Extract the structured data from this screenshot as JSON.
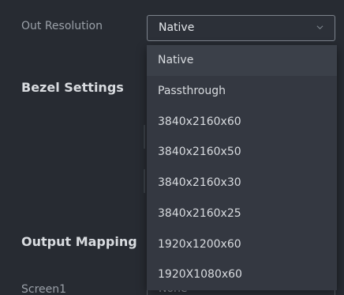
{
  "out_resolution": {
    "label": "Out Resolution",
    "value": "Native"
  },
  "sections": {
    "bezel_title": "Bezel Settings",
    "mapping_title": "Output Mapping"
  },
  "screen1": {
    "label": "Screen1",
    "value": "None"
  },
  "dropdown": {
    "options": [
      "Native",
      "Passthrough",
      "3840x2160x60",
      "3840x2160x50",
      "3840x2160x30",
      "3840x2160x25",
      "1920x1200x60",
      "1920X1080x60"
    ]
  },
  "icons": {
    "chevron": "chevron-down-icon"
  },
  "colors": {
    "background": "#272b32",
    "dropdown_bg": "#343841",
    "selected_bg": "#3b4049"
  }
}
